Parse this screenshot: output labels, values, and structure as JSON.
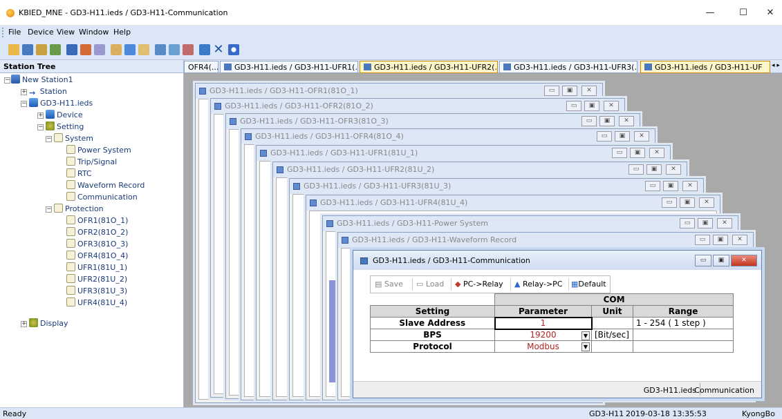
{
  "window": {
    "title": "KBIED_MNE - GD3-H11.ieds / GD3-H11-Communication",
    "minimize": "—",
    "maximize": "☐",
    "close": "✕"
  },
  "menu": [
    "File",
    "Device",
    "View",
    "Window",
    "Help"
  ],
  "toolbar_icons": [
    "open-icon",
    "save-icon",
    "device-icon",
    "tree-icon",
    "list-icon",
    "download-icon",
    "upload-icon",
    "settings-icon",
    "monitor-icon",
    "table-icon",
    "window-icon",
    "cascade-icon",
    "tile-icon",
    "relay-icon",
    "close-icon",
    "help-icon"
  ],
  "tree": {
    "header": "Station Tree",
    "items": [
      {
        "label": "New Station1"
      },
      {
        "label": "Station"
      },
      {
        "label": "GD3-H11.ieds"
      },
      {
        "label": "Device"
      },
      {
        "label": "Setting"
      },
      {
        "label": "System"
      },
      {
        "label": "Power System"
      },
      {
        "label": "Trip/Signal"
      },
      {
        "label": "RTC"
      },
      {
        "label": "Waveform Record"
      },
      {
        "label": "Communication"
      },
      {
        "label": "Protection"
      },
      {
        "label": "OFR1(81O_1)"
      },
      {
        "label": "OFR2(81O_2)"
      },
      {
        "label": "OFR3(81O_3)"
      },
      {
        "label": "OFR4(81O_4)"
      },
      {
        "label": "UFR1(81U_1)"
      },
      {
        "label": "UFR2(81U_2)"
      },
      {
        "label": "UFR3(81U_3)"
      },
      {
        "label": "UFR4(81U_4)"
      },
      {
        "label": "Display"
      }
    ]
  },
  "tabs": [
    "OFR4(...",
    "GD3-H11.ieds / GD3-H11-UFR1(...",
    "GD3-H11.ieds / GD3-H11-UFR2(...",
    "GD3-H11.ieds / GD3-H11-UFR3(...",
    "GD3-H11.ieds / GD3-H11-UF"
  ],
  "tab_nav": "◂ ▸ ✕",
  "child_windows": [
    "GD3-H11.ieds / GD3-H11-OFR1(81O_1)",
    "GD3-H11.ieds / GD3-H11-OFR2(81O_2)",
    "GD3-H11.ieds / GD3-H11-OFR3(81O_3)",
    "GD3-H11.ieds / GD3-H11-OFR4(81O_4)",
    "GD3-H11.ieds / GD3-H11-UFR1(81U_1)",
    "GD3-H11.ieds / GD3-H11-UFR2(81U_2)",
    "GD3-H11.ieds / GD3-H11-UFR3(81U_3)",
    "GD3-H11.ieds / GD3-H11-UFR4(81U_4)",
    "GD3-H11.ieds / GD3-H11-Power System",
    "GD3-H11.ieds / GD3-H11-Waveform Record"
  ],
  "comm": {
    "title": "GD3-H11.ieds / GD3-H11-Communication",
    "buttons": {
      "save": "Save",
      "load": "Load",
      "pc_relay": "PC->Relay",
      "relay_pc": "Relay->PC",
      "default": "Default"
    },
    "group": "COM",
    "headers": {
      "setting": "Setting",
      "parameter": "Parameter",
      "unit": "Unit",
      "range": "Range"
    },
    "rows": [
      {
        "setting": "Slave Address",
        "parameter": "1",
        "unit": "",
        "range": "1 - 254 ( 1 step )"
      },
      {
        "setting": "BPS",
        "parameter": "19200",
        "unit": "[Bit/sec]",
        "range": ""
      },
      {
        "setting": "Protocol",
        "parameter": "Modbus",
        "unit": "",
        "range": ""
      }
    ],
    "status": {
      "file": "GD3-H11.ieds",
      "page": "Communication"
    }
  },
  "statusbar": {
    "left": "Ready",
    "device": "GD3-H11",
    "datetime": "2019-03-18 13:35:53",
    "user": "KyongBo"
  }
}
